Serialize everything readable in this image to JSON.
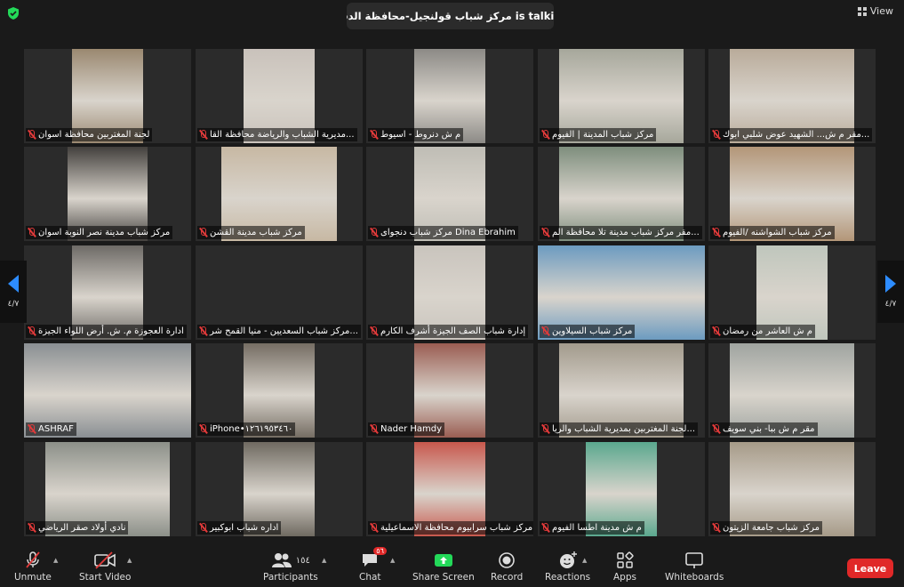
{
  "topbar": {
    "talking": "مركز شباب قولنجيل-محافظة الدقهلية is talking...",
    "view_label": "View"
  },
  "pager": {
    "left": "٤/٧",
    "right": "٤/٧"
  },
  "tiles": [
    {
      "name": "لجنة المغتربين محافظة اسوان"
    },
    {
      "name": "مديرية الشباب والرياضة محافظة القا..."
    },
    {
      "name": "م ش دنروط - اسيوط"
    },
    {
      "name": "مركز شباب المدينة | الفيوم"
    },
    {
      "name": "مقر م ش... الشهيد عوض شلبي ابوك..."
    },
    {
      "name": "مركز شباب مدينة نصر النوبة اسوان"
    },
    {
      "name": "مركز شباب مدينة القشن"
    },
    {
      "name": "مركز شباب دنجواى Dina Ebrahim"
    },
    {
      "name": "مقر مركز شباب مدينة تلا محافظة الم..."
    },
    {
      "name": "مركز شباب الشواشنه /الفيوم"
    },
    {
      "name": "ادارة العجوزة م. ش. أرض اللواء الجيزة"
    },
    {
      "name": "مركز شباب السعديين - منيا القمح شر..."
    },
    {
      "name": "إدارة شباب الصف الجيزة أشرف الكارم"
    },
    {
      "name": "مركز شباب السيلاوين"
    },
    {
      "name": "م ش العاشر من رمضان"
    },
    {
      "name": "ASHRAF"
    },
    {
      "name": "iPhone•١٢٦١٩٥٣٤٦٠"
    },
    {
      "name": "Nader Hamdy"
    },
    {
      "name": "لجنة المغتربين بمديرية الشباب والريا..."
    },
    {
      "name": "مقر م ش ببا- بني سويف"
    },
    {
      "name": "نادي أولاد صقر الرياضي"
    },
    {
      "name": "اداره شباب ابوكبير"
    },
    {
      "name": "مركز شباب سرابيوم محافظة الاسماعيلية"
    },
    {
      "name": "م ش مدينة اطسا الفيوم"
    },
    {
      "name": "مركز شباب جامعة الزيتون"
    }
  ],
  "toolbar": {
    "unmute": "Unmute",
    "start_video": "Start Video",
    "participants": "Participants",
    "participants_count": "١٥٤",
    "chat": "Chat",
    "chat_badge": "٥٦",
    "share_screen": "Share Screen",
    "record": "Record",
    "reactions": "Reactions",
    "apps": "Apps",
    "whiteboards": "Whiteboards",
    "leave": "Leave"
  },
  "colors": {
    "accent": "#2d8cff",
    "share": "#23d959",
    "leave": "#e02828",
    "muted": "#e23a3a"
  }
}
